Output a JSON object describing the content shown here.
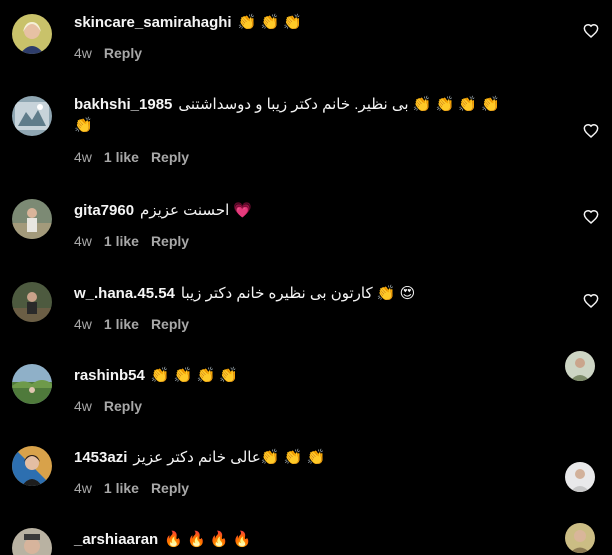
{
  "comments": [
    {
      "username": "skincare_samirahaghi",
      "text": "👏 👏 👏",
      "cont": "",
      "age": "4w",
      "likes": "",
      "reply": "Reply"
    },
    {
      "username": "bakhshi_1985",
      "text": "بی نظیر. خانم دکتر زیبا و دوسداشتنی 👏 👏 👏 👏",
      "cont": "👏",
      "age": "4w",
      "likes": "1 like",
      "reply": "Reply"
    },
    {
      "username": "gita7960",
      "text": "احسنت عزیزم 💗",
      "cont": "",
      "age": "4w",
      "likes": "1 like",
      "reply": "Reply"
    },
    {
      "username": "w_.hana.45.54",
      "text": "کارتون بی نظیره خانم دکتر زیبا 👏 😍",
      "cont": "",
      "age": "4w",
      "likes": "1 like",
      "reply": "Reply"
    },
    {
      "username": "rashinb54",
      "text": "👏 👏 👏 👏",
      "cont": "",
      "age": "4w",
      "likes": "",
      "reply": "Reply"
    },
    {
      "username": "1453azi",
      "text": "عالی خانم دکتر عزیز👏 👏 👏",
      "cont": "",
      "age": "4w",
      "likes": "1 like",
      "reply": "Reply"
    },
    {
      "username": "_arshiaaran",
      "text": "🔥 🔥 🔥 🔥",
      "cont": "",
      "age": "",
      "likes": "",
      "reply": ""
    }
  ],
  "colors": {
    "background": "#000000",
    "text": "#f5f5f5",
    "meta": "#a8a8a8"
  }
}
